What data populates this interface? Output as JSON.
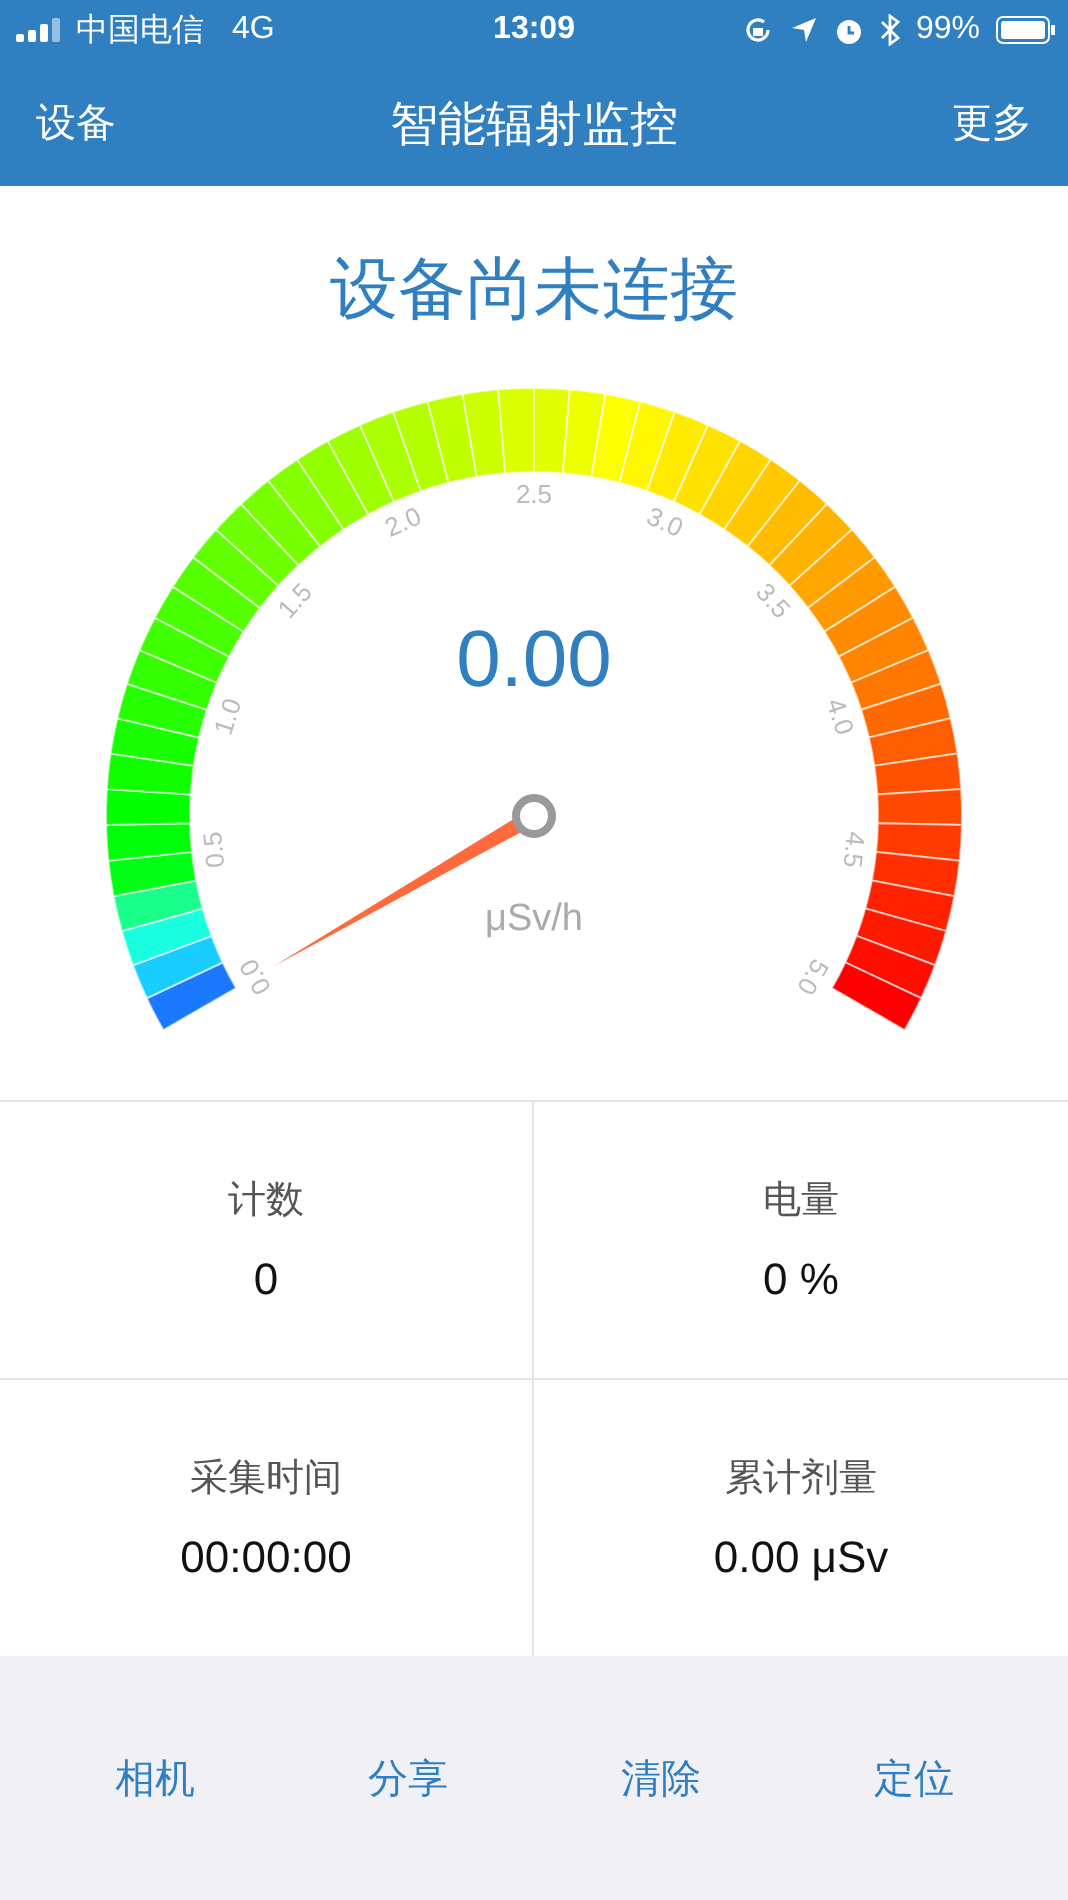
{
  "status_bar": {
    "carrier": "中国电信",
    "network": "4G",
    "time": "13:09",
    "battery": "99%"
  },
  "nav_bar": {
    "left": "设备",
    "title": "智能辐射监控",
    "right": "更多"
  },
  "connection_status": "设备尚未连接",
  "gauge": {
    "value": "0.00",
    "unit": "μSv/h",
    "scale_labels": [
      "0.0",
      "0.5",
      "1.0",
      "1.5",
      "2.0",
      "2.5",
      "3.0",
      "3.5",
      "4.0",
      "4.5",
      "5.0"
    ]
  },
  "stats": [
    {
      "label": "计数",
      "value": "0"
    },
    {
      "label": "电量",
      "value": "0 %"
    },
    {
      "label": "采集时间",
      "value": "00:00:00"
    },
    {
      "label": "累计剂量",
      "value": "0.00 μSv"
    }
  ],
  "tab_bar": [
    "相机",
    "分享",
    "清除",
    "定位"
  ]
}
